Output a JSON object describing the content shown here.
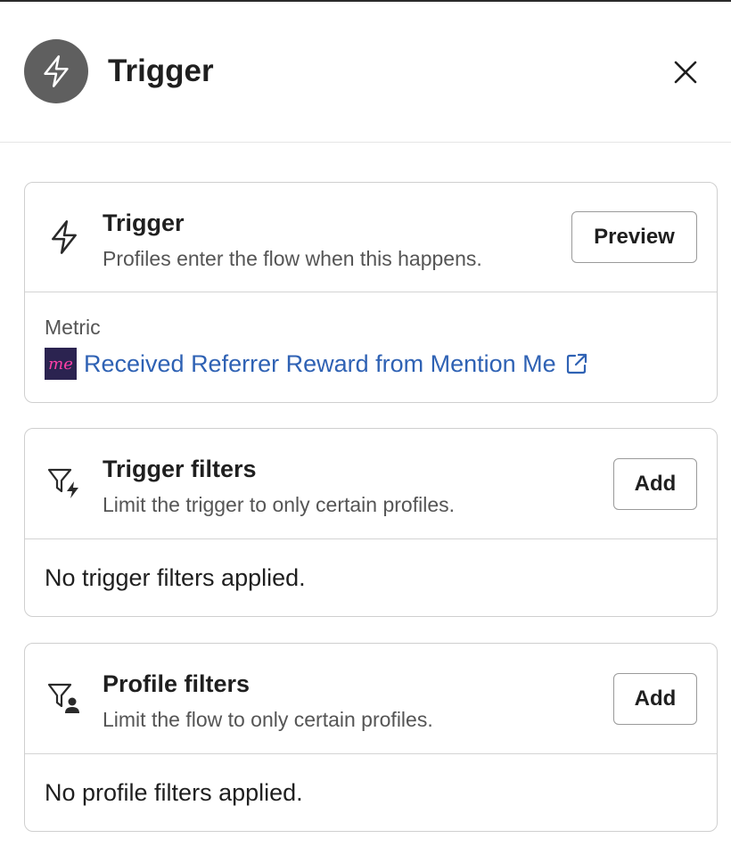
{
  "header": {
    "title": "Trigger",
    "icon": "lightning-icon",
    "close_icon": "close-icon"
  },
  "trigger_card": {
    "title": "Trigger",
    "subtitle": "Profiles enter the flow when this happens.",
    "button_label": "Preview",
    "icon": "lightning-icon",
    "metric_label": "Metric",
    "metric_logo_text": "me",
    "metric_name": "Received Referrer Reward from Mention Me",
    "metric_link_color": "#2f62b4"
  },
  "trigger_filters_card": {
    "title": "Trigger filters",
    "subtitle": "Limit the trigger to only certain profiles.",
    "button_label": "Add",
    "icon": "filter-lightning-icon",
    "empty_text": "No trigger filters applied."
  },
  "profile_filters_card": {
    "title": "Profile filters",
    "subtitle": "Limit the flow to only certain profiles.",
    "button_label": "Add",
    "icon": "filter-person-icon",
    "empty_text": "No profile filters applied."
  }
}
